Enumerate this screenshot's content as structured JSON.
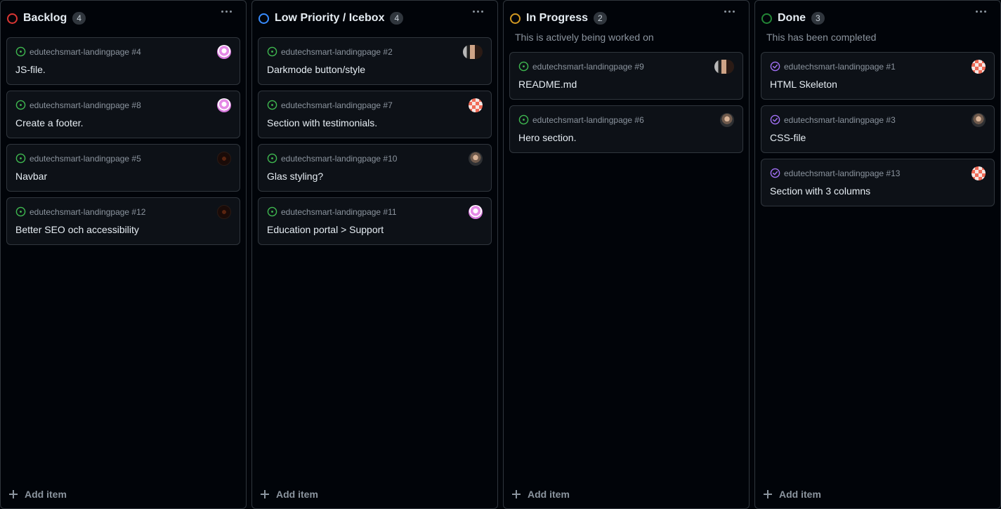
{
  "colors": {
    "background": "#010409",
    "card": "#0d1117",
    "border": "#30363d",
    "open_issue": "#3fb950",
    "closed_issue": "#a371f7"
  },
  "columns": [
    {
      "title": "Backlog",
      "count": "4",
      "status_color": "#da3633",
      "description": "",
      "add_label": "Add item",
      "cards": [
        {
          "repo": "edutechsmart-landingpage #4",
          "title": "JS-file.",
          "state": "open",
          "avatar": "pink"
        },
        {
          "repo": "edutechsmart-landingpage #8",
          "title": "Create a footer.",
          "state": "open",
          "avatar": "pink"
        },
        {
          "repo": "edutechsmart-landingpage #5",
          "title": "Navbar",
          "state": "open",
          "avatar": "brown"
        },
        {
          "repo": "edutechsmart-landingpage #12",
          "title": "Better SEO och accessibility",
          "state": "open",
          "avatar": "brown"
        }
      ]
    },
    {
      "title": "Low Priority / Icebox",
      "count": "4",
      "status_color": "#388bfd",
      "description": "",
      "add_label": "Add item",
      "cards": [
        {
          "repo": "edutechsmart-landingpage #2",
          "title": "Darkmode button/style",
          "state": "open",
          "avatar": "double"
        },
        {
          "repo": "edutechsmart-landingpage #7",
          "title": "Section with testimonials.",
          "state": "open",
          "avatar": "checker"
        },
        {
          "repo": "edutechsmart-landingpage #10",
          "title": "Glas styling?",
          "state": "open",
          "avatar": "face"
        },
        {
          "repo": "edutechsmart-landingpage #11",
          "title": "Education portal > Support",
          "state": "open",
          "avatar": "pink"
        }
      ]
    },
    {
      "title": "In Progress",
      "count": "2",
      "status_color": "#d29922",
      "description": "This is actively being worked on",
      "add_label": "Add item",
      "cards": [
        {
          "repo": "edutechsmart-landingpage #9",
          "title": "README.md",
          "state": "open",
          "avatar": "double"
        },
        {
          "repo": "edutechsmart-landingpage #6",
          "title": "Hero section.",
          "state": "open",
          "avatar": "face"
        }
      ]
    },
    {
      "title": "Done",
      "count": "3",
      "status_color": "#238636",
      "description": "This has been completed",
      "add_label": "Add item",
      "cards": [
        {
          "repo": "edutechsmart-landingpage #1",
          "title": "HTML Skeleton",
          "state": "closed",
          "avatar": "checker"
        },
        {
          "repo": "edutechsmart-landingpage #3",
          "title": "CSS-file",
          "state": "closed",
          "avatar": "face"
        },
        {
          "repo": "edutechsmart-landingpage #13",
          "title": "Section with 3 columns",
          "state": "closed",
          "avatar": "checker"
        }
      ]
    }
  ]
}
